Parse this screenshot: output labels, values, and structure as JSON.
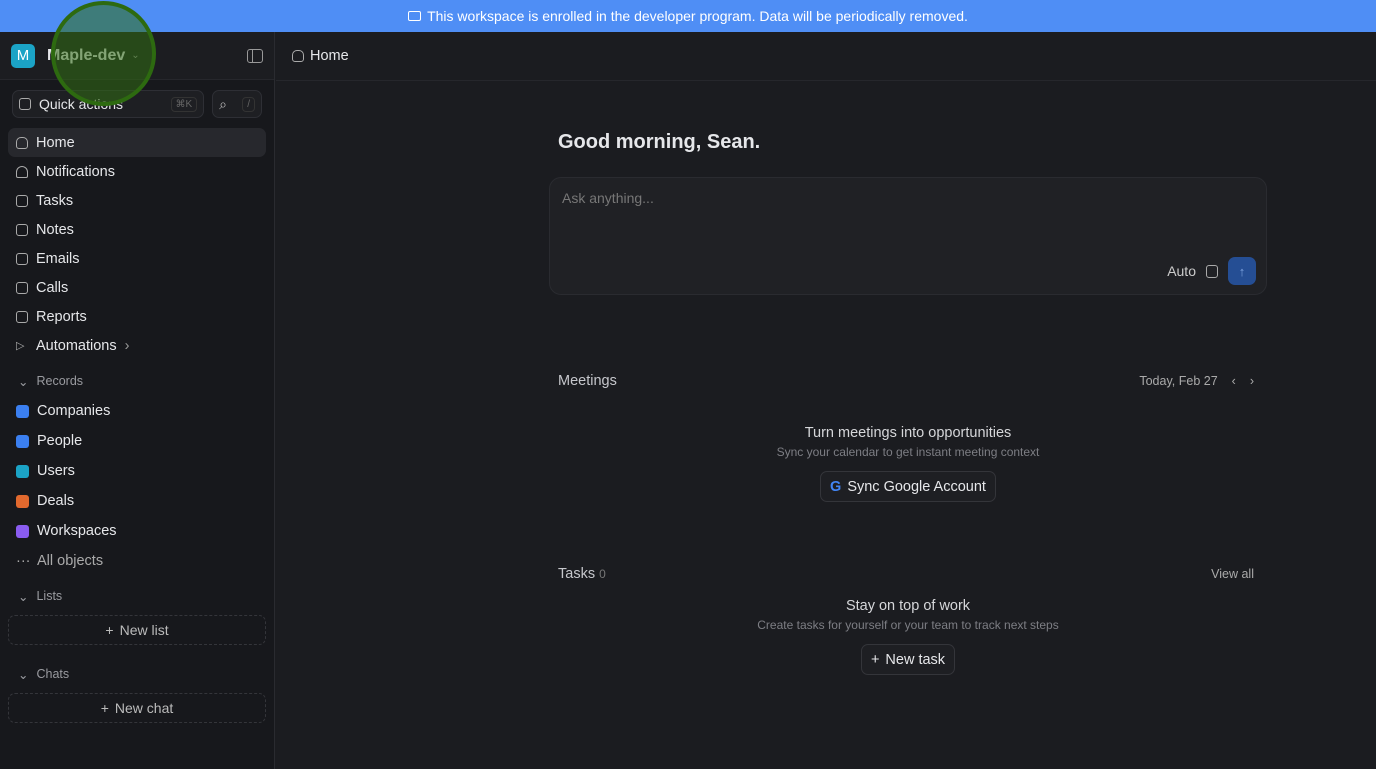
{
  "banner": {
    "text": "This workspace is enrolled in the developer program. Data will be periodically removed."
  },
  "workspace": {
    "initial": "M",
    "name": "Maple-dev"
  },
  "quick_actions": {
    "label": "Quick actions",
    "shortcut": "⌘K",
    "search_shortcut": "/"
  },
  "nav": [
    {
      "label": "Home"
    },
    {
      "label": "Notifications"
    },
    {
      "label": "Tasks"
    },
    {
      "label": "Notes"
    },
    {
      "label": "Emails"
    },
    {
      "label": "Calls"
    },
    {
      "label": "Reports"
    },
    {
      "label": "Automations"
    }
  ],
  "records": {
    "title": "Records",
    "items": [
      {
        "label": "Companies",
        "color": "#3b7ff0"
      },
      {
        "label": "People",
        "color": "#3b7ff0"
      },
      {
        "label": "Users",
        "color": "#1ba3c6"
      },
      {
        "label": "Deals",
        "color": "#e2692e"
      },
      {
        "label": "Workspaces",
        "color": "#8a5cf0"
      }
    ],
    "all": "All objects"
  },
  "lists": {
    "title": "Lists",
    "new": "New list"
  },
  "chats": {
    "title": "Chats",
    "new": "New chat"
  },
  "topbar": {
    "title": "Home"
  },
  "greeting": "Good morning, Sean.",
  "ask": {
    "placeholder": "Ask anything...",
    "mode": "Auto"
  },
  "meetings": {
    "title": "Meetings",
    "date": "Today, Feb 27",
    "empty_title": "Turn meetings into opportunities",
    "empty_sub": "Sync your calendar to get instant meeting context",
    "button": "Sync Google Account"
  },
  "tasks": {
    "title": "Tasks",
    "count": "0",
    "view_all": "View all",
    "empty_title": "Stay on top of work",
    "empty_sub": "Create tasks for yourself or your team to track next steps",
    "button": "New task"
  }
}
